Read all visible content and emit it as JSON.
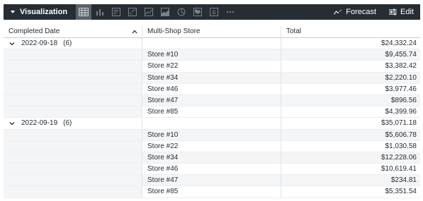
{
  "toolbar": {
    "visualization_label": "Visualization",
    "viz_icons": [
      "table-icon",
      "bar-chart-icon",
      "single-record-icon",
      "scatter-icon",
      "line-chart-icon",
      "area-chart-icon",
      "pie-chart-icon",
      "map-icon",
      "single-value-icon",
      "more-icon"
    ],
    "single_value_glyph": "6",
    "forecast_label": "Forecast",
    "edit_label": "Edit"
  },
  "table": {
    "headers": [
      "Completed Date",
      "Multi-Shop Store",
      "Total"
    ],
    "groups": [
      {
        "date": "2022-09-18",
        "count": "(6)",
        "total": "$24,332.24",
        "rows": [
          {
            "store": "Store #10",
            "total": "$9,455.74"
          },
          {
            "store": "Store #22",
            "total": "$3,382.42"
          },
          {
            "store": "Store #34",
            "total": "$2,220.10"
          },
          {
            "store": "Store #46",
            "total": "$3,977.46"
          },
          {
            "store": "Store #47",
            "total": "$896.56"
          },
          {
            "store": "Store #85",
            "total": "$4,399.96"
          }
        ]
      },
      {
        "date": "2022-09-19",
        "count": "(6)",
        "total": "$35,071.18",
        "rows": [
          {
            "store": "Store #10",
            "total": "$5,606.78"
          },
          {
            "store": "Store #22",
            "total": "$1,030.58"
          },
          {
            "store": "Store #34",
            "total": "$12,228.06"
          },
          {
            "store": "Store #46",
            "total": "$10,619.41"
          },
          {
            "store": "Store #47",
            "total": "$234.81"
          },
          {
            "store": "Store #85",
            "total": "$5,351.54"
          }
        ]
      }
    ]
  },
  "colors": {
    "toolbar_bg": "#262d33",
    "active_icon_bg": "#5a6168",
    "row_shade": "#f4f5f6",
    "text": "#262d33"
  }
}
